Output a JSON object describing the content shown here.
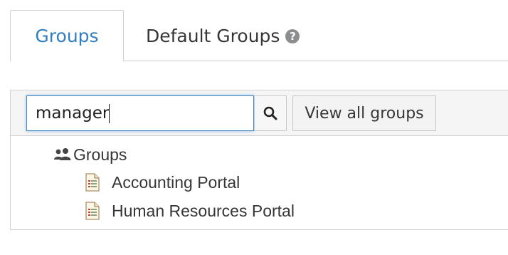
{
  "tabs": {
    "groups_label": "Groups",
    "default_groups_label": "Default Groups",
    "help_glyph": "?"
  },
  "search": {
    "value": "manager",
    "placeholder": "",
    "search_icon": "search-icon",
    "view_all_label": "View all groups"
  },
  "tree": {
    "root": {
      "label": "Groups",
      "icon": "users-icon"
    },
    "children": [
      {
        "label": "Accounting Portal",
        "icon": "document-icon"
      },
      {
        "label": "Human Resources Portal",
        "icon": "document-icon"
      }
    ]
  },
  "colors": {
    "accent": "#2f7fc2",
    "focus_border": "#3f88c5",
    "toolbar_bg": "#f5f5f5",
    "border": "#d1d1d1",
    "text": "#363636"
  }
}
